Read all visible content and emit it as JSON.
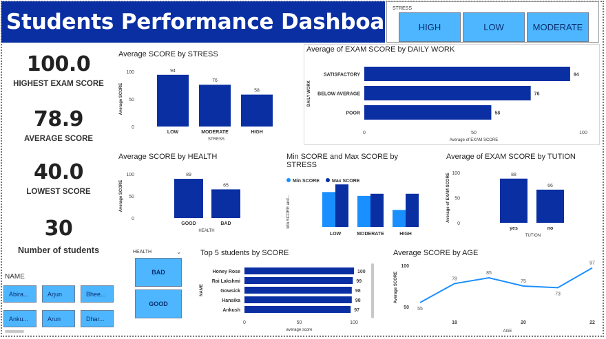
{
  "header": {
    "title": "Students Performance Dashboard"
  },
  "stress_slicer": {
    "label": "STRESS",
    "options": [
      "HIGH",
      "LOW",
      "MODERATE"
    ]
  },
  "kpis": [
    {
      "value": "100.0",
      "label": "HIGHEST EXAM SCORE"
    },
    {
      "value": "78.9",
      "label": "AVERAGE SCORE"
    },
    {
      "value": "40.0",
      "label": "LOWEST SCORE"
    },
    {
      "value": "30",
      "label": "Number of students"
    }
  ],
  "name_slicer": {
    "label": "NAME",
    "items": [
      "Abira...",
      "Arjun",
      "Bhee...",
      "Anku...",
      "Arun",
      "Dhar..."
    ]
  },
  "health_slicer": {
    "label": "HEALTH",
    "chevron": "chevron-down-icon",
    "options": [
      "BAD",
      "GOOD"
    ]
  },
  "colors": {
    "bar": "#0a2fa3",
    "light": "#1a8fff",
    "line": "#1a8fff",
    "title_bg": "#0a2fa3",
    "button": "#4db6ff"
  },
  "chart_data": [
    {
      "id": "stress",
      "type": "bar",
      "title": "Average SCORE by STRESS",
      "xlabel": "STRESS",
      "ylabel": "Average SCORE",
      "categories": [
        "LOW",
        "MODERATE",
        "HIGH"
      ],
      "values": [
        94,
        76,
        58
      ],
      "ylim": [
        0,
        100
      ],
      "yticks": [
        "0",
        "50",
        "100"
      ]
    },
    {
      "id": "daily",
      "type": "bar",
      "orientation": "horizontal",
      "title": "Average of EXAM SCORE by DAILY WORK",
      "xlabel": "Average of EXAM SCORE",
      "ylabel": "DAILY WORK",
      "categories": [
        "SATISFACTORY",
        "BELOW AVERAGE",
        "POOR"
      ],
      "values": [
        94,
        76,
        58
      ],
      "xlim": [
        0,
        100
      ],
      "xticks": [
        "0",
        "50",
        "100"
      ]
    },
    {
      "id": "health",
      "type": "bar",
      "title": "Average SCORE by HEALTH",
      "xlabel": "HEALTH",
      "ylabel": "Average SCORE",
      "categories": [
        "GOOD",
        "BAD"
      ],
      "values": [
        89,
        65
      ],
      "ylim": [
        0,
        100
      ],
      "yticks": [
        "0",
        "50",
        "100"
      ]
    },
    {
      "id": "minmax",
      "type": "bar",
      "title": "Min SCORE and Max SCORE by STRESS",
      "ylabel": "Min SCORE and...",
      "categories": [
        "LOW",
        "MODERATE",
        "HIGH"
      ],
      "series": [
        {
          "name": "Min SCORE",
          "values": [
            82,
            73,
            40
          ]
        },
        {
          "name": "Max SCORE",
          "values": [
            100,
            78,
            78
          ]
        }
      ],
      "ylim": [
        0,
        110
      ],
      "legend": "top-left"
    },
    {
      "id": "tution",
      "type": "bar",
      "title": "Average of EXAM SCORE by TUTION",
      "xlabel": "TUTION",
      "ylabel": "Average of EXAM SCORE",
      "categories": [
        "yes",
        "no"
      ],
      "values": [
        88,
        66
      ],
      "ylim": [
        0,
        100
      ],
      "yticks": [
        "0",
        "50",
        "100"
      ]
    },
    {
      "id": "top5",
      "type": "bar",
      "orientation": "horizontal",
      "title": "Top 5 students by SCORE",
      "xlabel": "average score",
      "ylabel": "NAME",
      "categories": [
        "Honey Rose",
        "Rai Lakshmi",
        "Gowsick",
        "Hansika",
        "Ankush"
      ],
      "values": [
        100,
        99,
        98,
        98,
        97
      ],
      "xlim": [
        0,
        100
      ],
      "xticks": [
        "0",
        "50",
        "100"
      ]
    },
    {
      "id": "age",
      "type": "line",
      "title": "Average SCORE by AGE",
      "xlabel": "AGE",
      "ylabel": "Average SCORE",
      "x": [
        17,
        18,
        19,
        20,
        21,
        22
      ],
      "values": [
        55,
        78,
        85,
        75,
        73,
        97
      ],
      "xticks": [
        "18",
        "20",
        "22"
      ],
      "yticks": [
        "50",
        "100"
      ],
      "ylim": [
        50,
        100
      ]
    }
  ]
}
